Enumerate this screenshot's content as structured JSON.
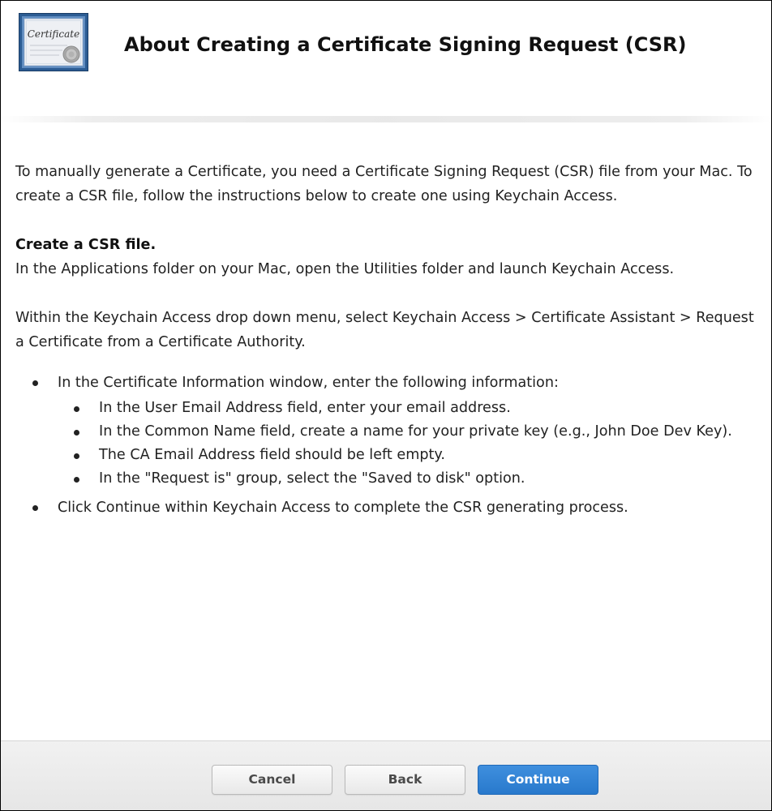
{
  "header": {
    "icon_name": "certificate-icon",
    "icon_text": "Certificate",
    "title": "About Creating a Certificate Signing Request (CSR)"
  },
  "content": {
    "intro": "To manually generate a Certificate, you need a Certificate Signing Request (CSR) file from your Mac. To create a CSR file, follow the instructions below to create one using Keychain Access.",
    "section_heading": "Create a CSR file.",
    "step1": "In the Applications folder on your Mac, open the Utilities folder and launch Keychain Access.",
    "step2": "Within the Keychain Access drop down menu, select Keychain Access > Certificate Assistant > Request a Certificate from a Certificate Authority.",
    "bullets": [
      {
        "text": "In the Certificate Information window, enter the following information:",
        "sub": [
          "In the User Email Address field, enter your email address.",
          "In the Common Name field, create a name for your private key (e.g., John Doe Dev Key).",
          "The CA Email Address field should be left empty.",
          "In the \"Request is\" group, select the \"Saved to disk\" option."
        ]
      },
      {
        "text": "Click Continue within Keychain Access to complete the CSR generating process."
      }
    ]
  },
  "footer": {
    "cancel_label": "Cancel",
    "back_label": "Back",
    "continue_label": "Continue"
  },
  "colors": {
    "primary_button": "#2f80d3",
    "secondary_button": "#f0f0f0",
    "footer_background": "#ececec"
  }
}
